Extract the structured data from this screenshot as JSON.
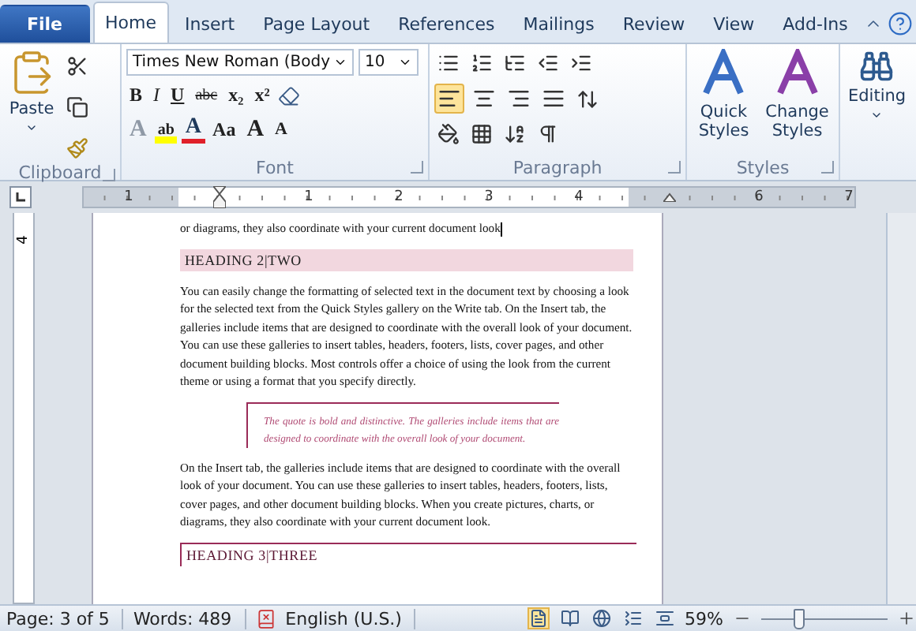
{
  "ribbon_tabs": [
    {
      "label": "File",
      "kind": "file",
      "selected": false
    },
    {
      "label": "Home",
      "kind": "tab",
      "selected": true
    },
    {
      "label": "Insert",
      "kind": "tab",
      "selected": false
    },
    {
      "label": "Page Layout",
      "kind": "tab",
      "selected": false
    },
    {
      "label": "References",
      "kind": "tab",
      "selected": false
    },
    {
      "label": "Mailings",
      "kind": "tab",
      "selected": false
    },
    {
      "label": "Review",
      "kind": "tab",
      "selected": false
    },
    {
      "label": "View",
      "kind": "tab",
      "selected": false
    },
    {
      "label": "Add-Ins",
      "kind": "tab",
      "selected": false
    }
  ],
  "clipboard": {
    "paste": "Paste",
    "label": "Clipboard"
  },
  "font": {
    "name": "Times New Roman (Body",
    "size": "10",
    "label": "Font",
    "format_buttons": [
      {
        "kind": "bold",
        "text": "B"
      },
      {
        "kind": "italic",
        "text": "I"
      },
      {
        "kind": "underline",
        "text": "U"
      },
      {
        "kind": "strike",
        "text": "abc"
      },
      {
        "kind": "sub",
        "text": "x₂"
      },
      {
        "kind": "sup",
        "text": "x²"
      }
    ],
    "effect_buttons": [
      {
        "kind": "effects",
        "text": "A",
        "disabled": true
      },
      {
        "kind": "highlight",
        "text": "ab",
        "disabled": false
      },
      {
        "kind": "color",
        "text": "A",
        "disabled": false
      },
      {
        "kind": "case",
        "text": "Aa",
        "disabled": false
      },
      {
        "kind": "grow",
        "text": "A",
        "disabled": false
      },
      {
        "kind": "shrink",
        "text": "A",
        "disabled": false
      }
    ]
  },
  "paragraph": {
    "label": "Paragraph",
    "alignments": [
      {
        "selected": true
      },
      {
        "selected": false
      },
      {
        "selected": false
      },
      {
        "selected": false
      }
    ]
  },
  "styles": {
    "label": "Styles",
    "buttons": [
      "Quick Styles",
      "Change Styles"
    ]
  },
  "editing": {
    "label": "Editing"
  },
  "ruler": {
    "marks": [
      {
        "kind": "number",
        "text": "1"
      },
      {
        "kind": "indent"
      },
      {
        "kind": "number",
        "text": "1"
      },
      {
        "kind": "number",
        "text": "2"
      },
      {
        "kind": "number",
        "text": "3"
      },
      {
        "kind": "number",
        "text": "4"
      },
      {
        "kind": "right"
      },
      {
        "kind": "number",
        "text": "6"
      },
      {
        "kind": "number",
        "text": "7"
      }
    ],
    "vertical_number": "4"
  },
  "document": {
    "blocks": [
      {
        "kind": "text",
        "text": "or diagrams, they also coordinate with your current document look"
      },
      {
        "kind": "heading2",
        "text": "HEADING 2|TWO"
      },
      {
        "kind": "text",
        "text": "You can easily change the formatting of selected text in the document text by choosing a look for the selected text from the Quick Styles gallery on the Write tab. On the Insert tab, the galleries include items that are designed to coordinate with the overall look of your document.  You can use these galleries to insert tables, headers, footers, lists, cover pages, and other document building blocks. Most controls offer a choice of using the look from the current theme or using a format that you specify directly."
      },
      {
        "kind": "quote",
        "text": "The quote is bold and distinctive. The galleries include items that are designed to coordinate with the overall look of your document."
      },
      {
        "kind": "text",
        "text": "On the Insert tab, the galleries include items that are designed to coordinate with the overall look of your document.  You can use these galleries to insert tables, headers, footers, lists, cover pages, and other document building blocks.  When you create pictures, charts, or diagrams, they also coordinate with your current document look."
      },
      {
        "kind": "heading3",
        "text": "HEADING 3|THREE"
      }
    ]
  },
  "status_bar": {
    "page": "Page: 3 of 5",
    "words": "Words: 489",
    "language": "English (U.S.)",
    "views": [
      {
        "selected": true
      },
      {
        "selected": false
      },
      {
        "selected": false
      },
      {
        "selected": false
      },
      {
        "selected": false
      }
    ],
    "zoom": "59%",
    "zoom_slider": {
      "level": 0.3
    }
  }
}
